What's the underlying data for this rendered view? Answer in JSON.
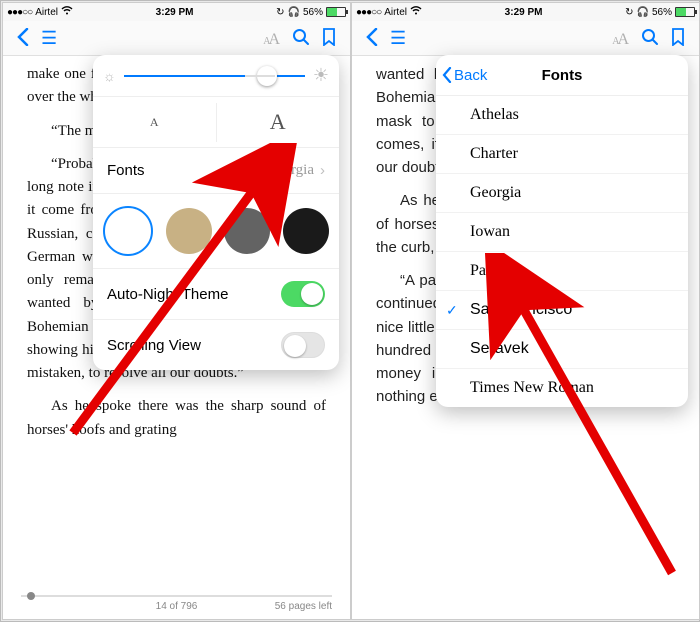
{
  "status": {
    "carrier": "Airtel",
    "time": "3:29 PM",
    "battery_pct": "56%"
  },
  "left": {
    "reader": {
      "p1": "make one feel as if one were on a cloud floating over the whole city.",
      "p2": "“The man is a German,” said the Bohemian.",
      "p3": "“Probably,” said the other. “He wrote that long note in a single sentence. A Frenchman, had it come from a Frenchman, would have been a Russian, could not have written that. It is the German who is so uncourteous to his verbs. It only remains, therefore, to discover what is wanted by this German who writes upon Bohemian paper and prefers wearing a mask to showing his face. And here he comes, if I am not mistaken, to resolve all our doubts.”",
      "p4": "As he spoke there was the sharp sound of horses' hoofs and grating"
    },
    "footer": {
      "center": "14 of 796",
      "right": "56 pages left"
    },
    "popover": {
      "fonts_label": "Fonts",
      "fonts_value": "Georgia",
      "auto_night_label": "Auto-Night Theme",
      "scrolling_label": "Scrolling View"
    }
  },
  "right": {
    "reader": {
      "p1": "wanted by this German who writes upon Bohemian paper and prefers wearing a mask to showing his face. And here he comes, if I am not mistaken, to resolve all our doubts.”",
      "p2": "As he spoke there was the sharp sound of horses' hoofs and grating wheels against the curb, followed by a sharp pull at the bell.",
      "p3": "“A pair, by the sound,” said he. “Yes,” he continued, glancing out of the window. “A nice little brougham and a pair of beauties. A hundred and fifty guineas apiece. There's money in this case, Watson, if there is nothing else.”"
    },
    "fonts_panel": {
      "back": "Back",
      "title": "Fonts",
      "items": [
        {
          "label": "Athelas",
          "selected": false,
          "ff": "ff-athelas"
        },
        {
          "label": "Charter",
          "selected": false,
          "ff": "ff-charter"
        },
        {
          "label": "Georgia",
          "selected": false,
          "ff": "ff-georgia"
        },
        {
          "label": "Iowan",
          "selected": false,
          "ff": "ff-iowan"
        },
        {
          "label": "Palatino",
          "selected": false,
          "ff": "ff-palatino"
        },
        {
          "label": "San Francisco",
          "selected": true,
          "ff": "ff-sf"
        },
        {
          "label": "Seravek",
          "selected": false,
          "ff": "ff-seravek"
        },
        {
          "label": "Times New Roman",
          "selected": false,
          "ff": "ff-times"
        }
      ]
    }
  }
}
